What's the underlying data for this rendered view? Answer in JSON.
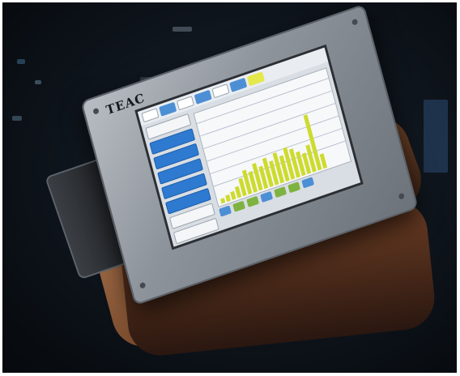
{
  "photo": {
    "device": {
      "brand_text": "TEAC",
      "model_text": "",
      "screen": {
        "chart_bars_count_visible": 20
      }
    }
  }
}
